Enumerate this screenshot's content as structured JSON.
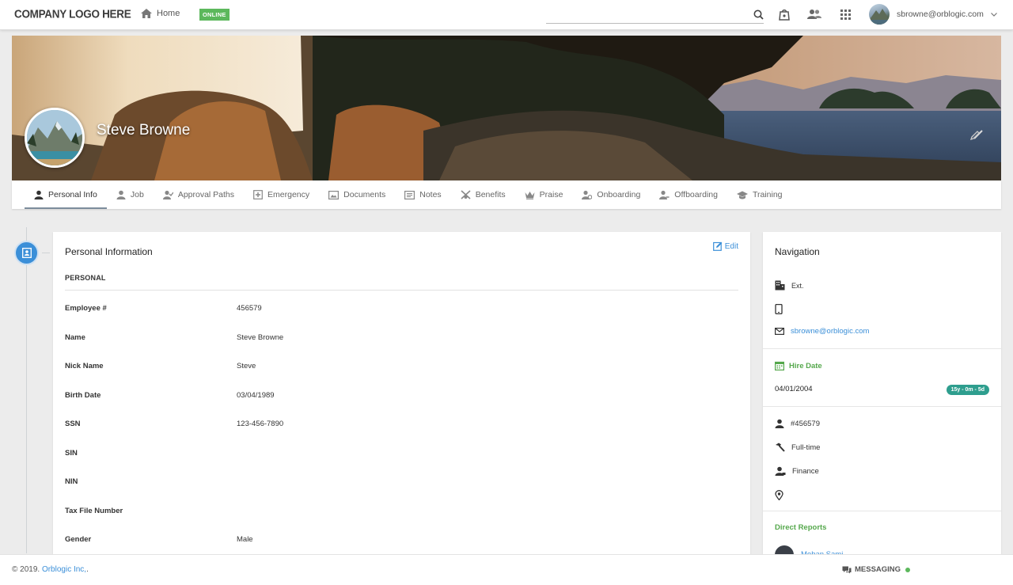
{
  "topbar": {
    "logo_text": "COMPANY LOGO HERE",
    "home_label": "Home",
    "status_badge": "ONLINE",
    "search_placeholder": "",
    "user_email": "sbrowne@orblogic.com"
  },
  "profile": {
    "name": "Steve Browne"
  },
  "tabs": [
    {
      "label": "Personal Info",
      "icon": "person-icon",
      "active": true
    },
    {
      "label": "Job",
      "icon": "person-icon"
    },
    {
      "label": "Approval Paths",
      "icon": "approval-icon"
    },
    {
      "label": "Emergency",
      "icon": "emergency-icon"
    },
    {
      "label": "Documents",
      "icon": "documents-icon"
    },
    {
      "label": "Notes",
      "icon": "notes-icon"
    },
    {
      "label": "Benefits",
      "icon": "benefits-icon"
    },
    {
      "label": "Praise",
      "icon": "crown-icon"
    },
    {
      "label": "Onboarding",
      "icon": "onboarding-icon"
    },
    {
      "label": "Offboarding",
      "icon": "offboarding-icon"
    },
    {
      "label": "Training",
      "icon": "graduation-cap-icon"
    }
  ],
  "personal": {
    "title": "Personal Information",
    "edit_label": "Edit",
    "section": "PERSONAL",
    "fields": [
      {
        "label": "Employee #",
        "value": "456579"
      },
      {
        "label": "Name",
        "value": "Steve Browne"
      },
      {
        "label": "Nick Name",
        "value": "Steve"
      },
      {
        "label": "Birth Date",
        "value": "03/04/1989"
      },
      {
        "label": "SSN",
        "value": "123-456-7890"
      },
      {
        "label": "SIN",
        "value": ""
      },
      {
        "label": "NIN",
        "value": ""
      },
      {
        "label": "Tax File Number",
        "value": ""
      },
      {
        "label": "Gender",
        "value": "Male"
      }
    ]
  },
  "navigation": {
    "title": "Navigation",
    "ext_label": "Ext.",
    "phone": "",
    "email": "sbrowne@orblogic.com",
    "hire_date_label": "Hire Date",
    "hire_date": "04/01/2004",
    "tenure": "15y - 0m - 5d",
    "employee_no": "#456579",
    "employment_type": "Full-time",
    "department": "Finance",
    "location": "",
    "direct_reports_label": "Direct Reports",
    "direct_reports": [
      {
        "name": "Mohan Sami"
      }
    ]
  },
  "footer": {
    "copyright_prefix": "© 2019.",
    "company": "Orblogic Inc,",
    "copyright_suffix": ".",
    "messaging_label": "MESSAGING"
  },
  "colors": {
    "accent_blue": "#3b8fd8",
    "online_green": "#5cb85c",
    "hire_green": "#55a84c",
    "tenure_teal": "#2e9e8e"
  }
}
